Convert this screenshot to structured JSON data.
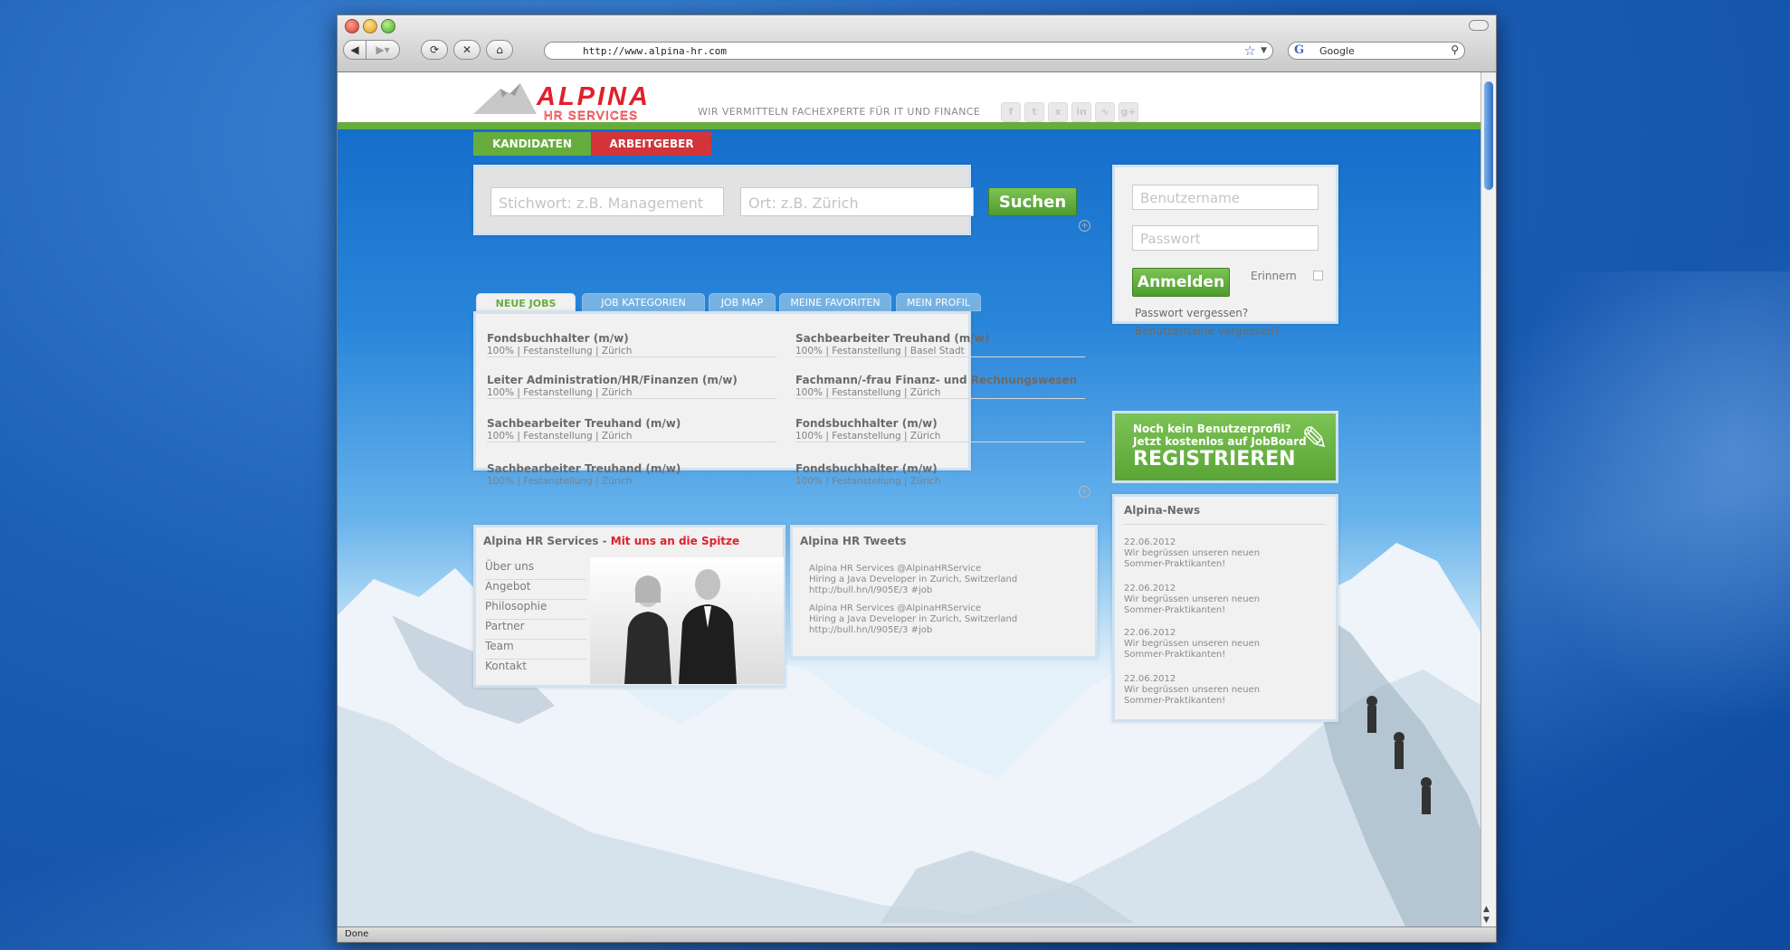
{
  "browser": {
    "url": "http://www.alpina-hr.com",
    "search_engine": "Google",
    "status": "Done",
    "icons": [
      "back-icon",
      "forward-icon",
      "reload-icon",
      "stop-icon",
      "home-icon",
      "bookmark-star-icon",
      "search-icon"
    ]
  },
  "site": {
    "logo": {
      "name": "ALPINA",
      "sub": "HR SERVICES"
    },
    "tagline": "WIR VERMITTELN FACHEXPERTE FÜR IT UND FINANCE",
    "social_icons": [
      "facebook-icon",
      "twitter-icon",
      "xing-icon",
      "linkedin-icon",
      "rss-icon",
      "google-plus-icon"
    ],
    "colors": {
      "brand_red": "#e0202a",
      "brand_green": "#66ad3e",
      "tab_blue": "#75b2e2"
    }
  },
  "nav": {
    "candidates": "KANDIDATEN",
    "employers": "ARBEITGEBER"
  },
  "search": {
    "keyword_placeholder": "Stichwort: z.B. Management",
    "location_placeholder": "Ort: z.B. Zürich",
    "button": "Suchen"
  },
  "jobs_tabs": [
    "NEUE JOBS",
    "JOB KATEGORIEN",
    "JOB MAP",
    "MEINE FAVORITEN",
    "MEIN PROFIL"
  ],
  "jobs": [
    {
      "title": "Fondsbuchhalter (m/w)",
      "detail": "100% | Festanstellung | Zürich"
    },
    {
      "title": "Leiter Administration/HR/Finanzen (m/w)",
      "detail": "100% | Festanstellung | Zürich"
    },
    {
      "title": "Sachbearbeiter Treuhand (m/w)",
      "detail": "100% | Festanstellung | Zürich"
    },
    {
      "title": "Sachbearbeiter Treuhand (m/w)",
      "detail": "100% | Festanstellung | Zürich"
    },
    {
      "title": "Sachbearbeiter Treuhand (m/w)",
      "detail": "100% | Festanstellung | Basel Stadt"
    },
    {
      "title": "Fachmann/-frau Finanz- und Rechnungswesen",
      "detail": "100% | Festanstellung | Zürich"
    },
    {
      "title": "Fondsbuchhalter (m/w)",
      "detail": "100% | Festanstellung | Zürich"
    },
    {
      "title": "Fondsbuchhalter (m/w)",
      "detail": "100% | Festanstellung | Zürich"
    }
  ],
  "about": {
    "title": "Alpina HR Services - ",
    "highlight": "Mit uns an die Spitze",
    "menu": [
      "Über uns",
      "Angebot",
      "Philosophie",
      "Partner",
      "Team",
      "Kontakt"
    ]
  },
  "tweets": {
    "title": "Alpina HR Tweets",
    "items": [
      {
        "author": "Alpina HR Services @AlpinaHRService",
        "text": "Hiring a Java Developer in Zurich, Switzerland",
        "link": "http://bull.hn/l/905E/3  #job"
      },
      {
        "author": "Alpina HR Services @AlpinaHRService",
        "text": "Hiring a Java Developer in Zurich, Switzerland",
        "link": "http://bull.hn/l/905E/3  #job"
      }
    ]
  },
  "login": {
    "username_placeholder": "Benutzername",
    "password_placeholder": "Passwort",
    "button": "Anmelden",
    "remember": "Erinnern",
    "forgot_password": "Passwort vergessen?",
    "forgot_username": "Benutzername vergessen?"
  },
  "register": {
    "line1": "Noch kein Benutzerprofil?",
    "line2": "Jetzt kostenlos auf JobBoard",
    "button": "REGISTRIEREN"
  },
  "news": {
    "title": "Alpina-News",
    "items": [
      {
        "date": "22.06.2012",
        "line1": "Wir begrüssen unseren neuen",
        "line2": "Sommer-Praktikanten!"
      },
      {
        "date": "22.06.2012",
        "line1": "Wir begrüssen unseren neuen",
        "line2": "Sommer-Praktikanten!"
      },
      {
        "date": "22.06.2012",
        "line1": "Wir begrüssen unseren neuen",
        "line2": "Sommer-Praktikanten!"
      },
      {
        "date": "22.06.2012",
        "line1": "Wir begrüssen unseren neuen",
        "line2": "Sommer-Praktikanten!"
      }
    ]
  }
}
